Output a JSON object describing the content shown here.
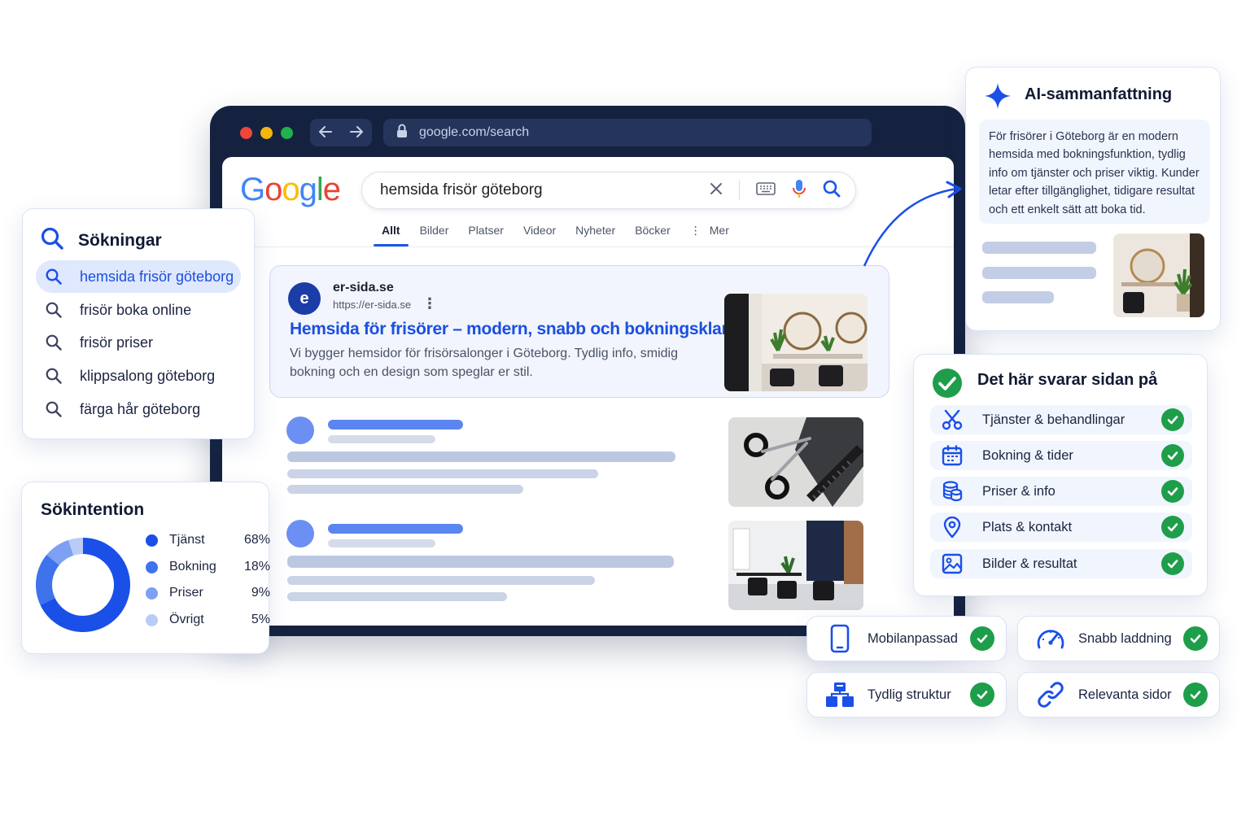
{
  "browser": {
    "url": "google.com/search",
    "search_query": "hemsida frisör göteborg",
    "logo_letters": [
      "G",
      "o",
      "o",
      "g",
      "l",
      "e"
    ],
    "logo_colors": [
      "#4285F4",
      "#EA4335",
      "#FBBC05",
      "#4285F4",
      "#34A853",
      "#EA4335"
    ],
    "tabs": [
      "Allt",
      "Bilder",
      "Platser",
      "Videor",
      "Nyheter",
      "Böcker",
      "Mer"
    ],
    "active_tab": "Allt"
  },
  "result": {
    "favicon_letter": "e",
    "site_name": "er-sida.se",
    "site_url": "https://er-sida.se",
    "title": "Hemsida för frisörer – modern, snabb och bokningsklar",
    "description": "Vi bygger hemsidor för frisörsalonger i Göteborg. Tydlig info, smidig bokning och en design som speglar er stil."
  },
  "searches": {
    "title": "Sökningar",
    "items": [
      "hemsida frisör göteborg",
      "frisör boka online",
      "frisör priser",
      "klippsalong göteborg",
      "färga hår göteborg"
    ]
  },
  "intent": {
    "title": "Sökintention",
    "items": [
      {
        "label": "Tjänst",
        "value": "68%",
        "color": "#1a4fe8"
      },
      {
        "label": "Bokning",
        "value": "18%",
        "color": "#3f73ec"
      },
      {
        "label": "Priser",
        "value": "9%",
        "color": "#7da0f2"
      },
      {
        "label": "Övrigt",
        "value": "5%",
        "color": "#b9cbf7"
      }
    ]
  },
  "chart_data": {
    "type": "pie",
    "title": "Sökintention",
    "categories": [
      "Tjänst",
      "Bokning",
      "Priser",
      "Övrigt"
    ],
    "values": [
      68,
      18,
      9,
      5
    ]
  },
  "ai_summary": {
    "title": "AI-sammanfattning",
    "text": "För frisörer i Göteborg är en modern hemsida med bokningsfunktion, tydlig info om tjänster och priser viktig. Kunder letar efter tillgänglighet, tidigare resultat och ett enkelt sätt att boka tid."
  },
  "answers": {
    "title": "Det här svarar sidan på",
    "items": [
      {
        "label": "Tjänster & behandlingar",
        "icon": "scissors-icon"
      },
      {
        "label": "Bokning & tider",
        "icon": "calendar-icon"
      },
      {
        "label": "Priser & info",
        "icon": "coins-icon"
      },
      {
        "label": "Plats & kontakt",
        "icon": "location-pin-icon"
      },
      {
        "label": "Bilder & resultat",
        "icon": "image-icon"
      }
    ]
  },
  "features": [
    {
      "label": "Mobilanpassad",
      "icon": "mobile-icon"
    },
    {
      "label": "Snabb laddning",
      "icon": "speedometer-icon"
    },
    {
      "label": "Tydlig struktur",
      "icon": "structure-icon"
    },
    {
      "label": "Relevanta sidor",
      "icon": "link-icon"
    }
  ],
  "colors": {
    "accent": "#1a4fe8",
    "check": "#1e9e4a",
    "browser_frame": "#15223f"
  }
}
